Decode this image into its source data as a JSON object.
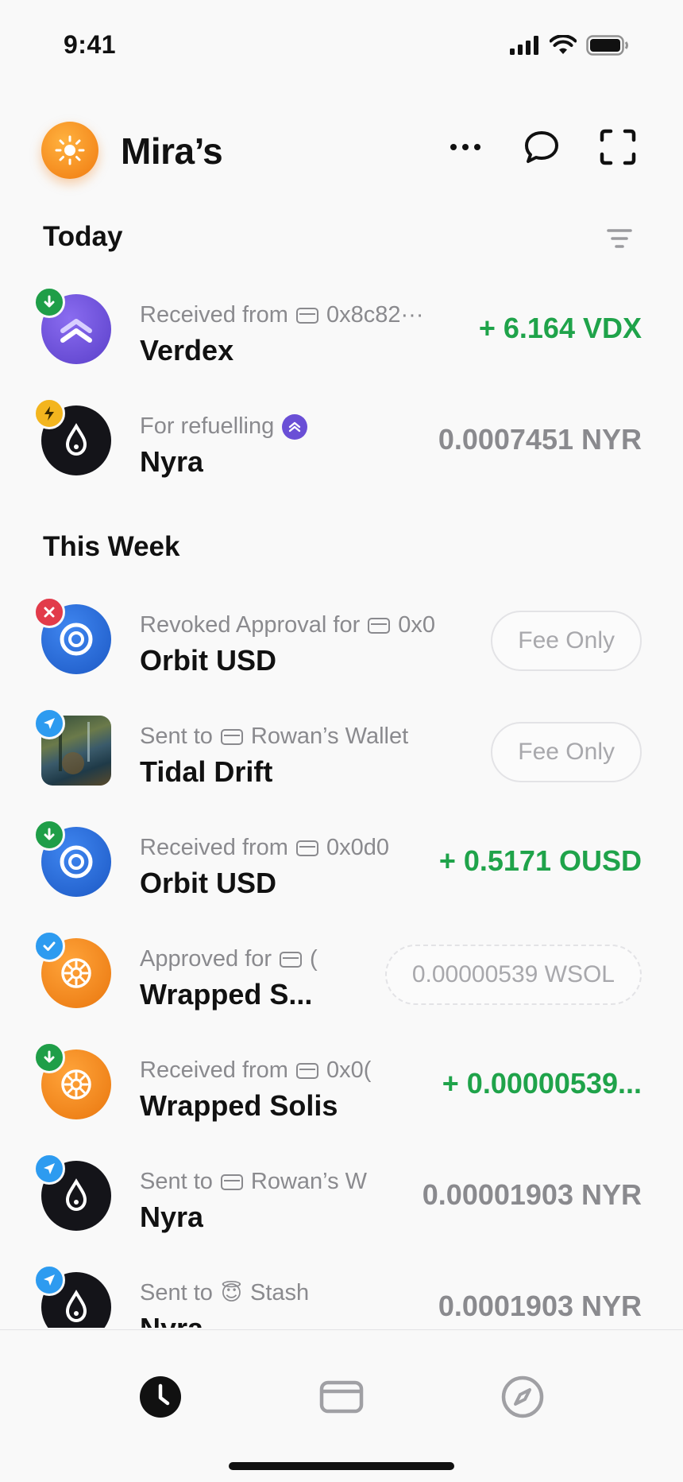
{
  "status_bar": {
    "time": "9:41"
  },
  "header": {
    "title": "Mira’s",
    "avatar_icon": "sun-icon",
    "actions": [
      "more-icon",
      "chat-icon",
      "scan-icon"
    ]
  },
  "sections": [
    {
      "title": "Today",
      "items": [
        {
          "subtitle": "Received from",
          "wallet": "0x8c82···",
          "name": "Verdex",
          "amount": "+ 6.164 VDX",
          "amount_style": "green",
          "badge": "receive",
          "token": "verdex"
        },
        {
          "subtitle": "For refuelling",
          "wallet": "",
          "name": "Nyra",
          "amount": "0.0007451 NYR",
          "amount_style": "gray",
          "badge": "refuel",
          "token": "nyra"
        }
      ]
    },
    {
      "title": "This Week",
      "items": [
        {
          "subtitle": "Revoked Approval for",
          "wallet": "0x0",
          "name": "Orbit USD",
          "pill": "Fee Only",
          "badge": "revoke",
          "token": "orbit"
        },
        {
          "subtitle": "Sent to",
          "wallet": "Rowan’s Wallet",
          "name": "Tidal Drift",
          "pill": "Fee Only",
          "badge": "send",
          "token": "nft"
        },
        {
          "subtitle": "Received from",
          "wallet": "0x0d0",
          "name": "Orbit USD",
          "amount": "+ 0.5171 OUSD",
          "amount_style": "green",
          "badge": "receive",
          "token": "orbit"
        },
        {
          "subtitle": "Approved for",
          "wallet": "(",
          "name": "Wrapped S...",
          "pill_dashed": "0.00000539 WSOL",
          "badge": "approve",
          "token": "wsol"
        },
        {
          "subtitle": "Received from",
          "wallet": "0x0(",
          "name": "Wrapped Solis",
          "amount": "+ 0.00000539...",
          "amount_style": "green",
          "badge": "receive",
          "token": "wsol"
        },
        {
          "subtitle": "Sent to",
          "wallet": "Rowan’s W",
          "name": "Nyra",
          "amount": "0.00001903 NYR",
          "amount_style": "gray",
          "badge": "send",
          "token": "nyra"
        },
        {
          "subtitle": "Sent to",
          "emoji": "😇",
          "wallet": "Stash",
          "name": "Nyra",
          "amount": "0.0001903 NYR",
          "amount_style": "gray",
          "badge": "send",
          "token": "nyra"
        }
      ]
    }
  ],
  "tabbar": {
    "tabs": [
      "history-icon",
      "wallet-icon",
      "explore-icon"
    ],
    "active": 0
  },
  "colors": {
    "green": "#1fa34a",
    "gray_text": "#8a8a8e",
    "orange": "#f28a18",
    "purple": "#6a4fd6",
    "blue": "#2d6fdc"
  }
}
